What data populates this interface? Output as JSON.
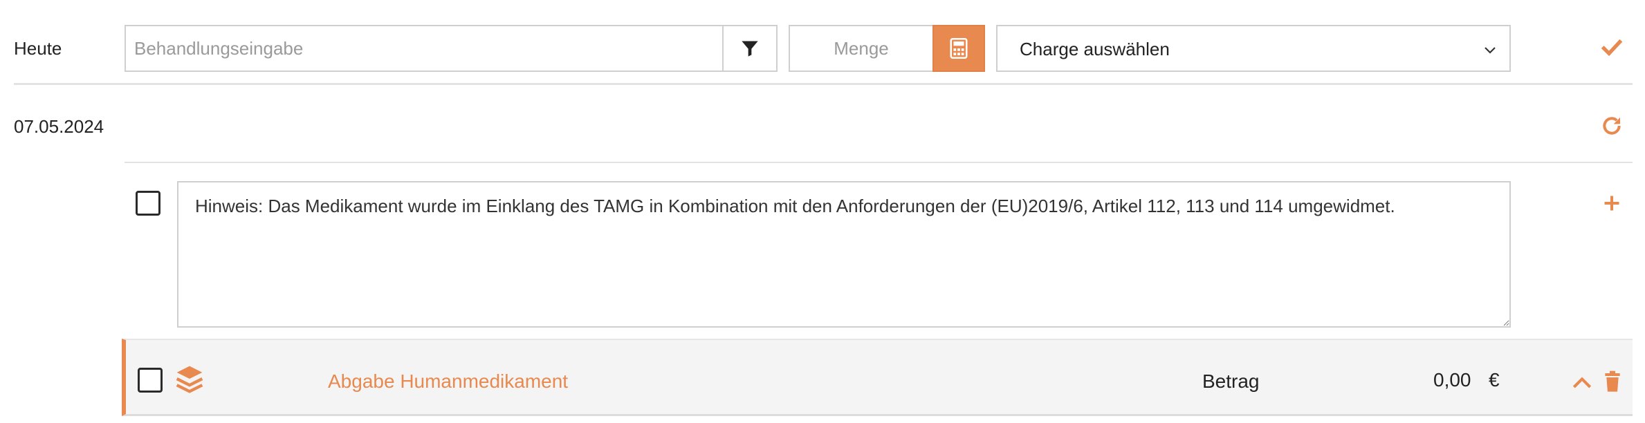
{
  "colors": {
    "accent": "#e8894f",
    "border": "#cfcfcf",
    "row_bg": "#f4f4f4"
  },
  "toolbar": {
    "date_label": "Heute",
    "treatment_placeholder": "Behandlungseingabe",
    "filter_icon": "filter-icon",
    "quantity_placeholder": "Menge",
    "calculator_icon": "calculator-icon",
    "batch_select_value": "Charge auswählen",
    "confirm_icon": "checkmark-icon"
  },
  "entry": {
    "date": "07.05.2024",
    "refresh_icon": "refresh-icon",
    "note_text": "Hinweis: Das Medikament wurde im Einklang des TAMG in Kombination mit den Anforderungen der (EU)2019/6, Artikel 112, 113 und 114 umgewidmet.",
    "add_icon": "plus-icon"
  },
  "line_item": {
    "icon": "layers-icon",
    "title": "Abgabe Humanmedikament",
    "amount_label": "Betrag",
    "amount_value": "0,00",
    "currency": "€",
    "collapse_icon": "chevron-up-icon",
    "delete_icon": "trash-icon"
  }
}
